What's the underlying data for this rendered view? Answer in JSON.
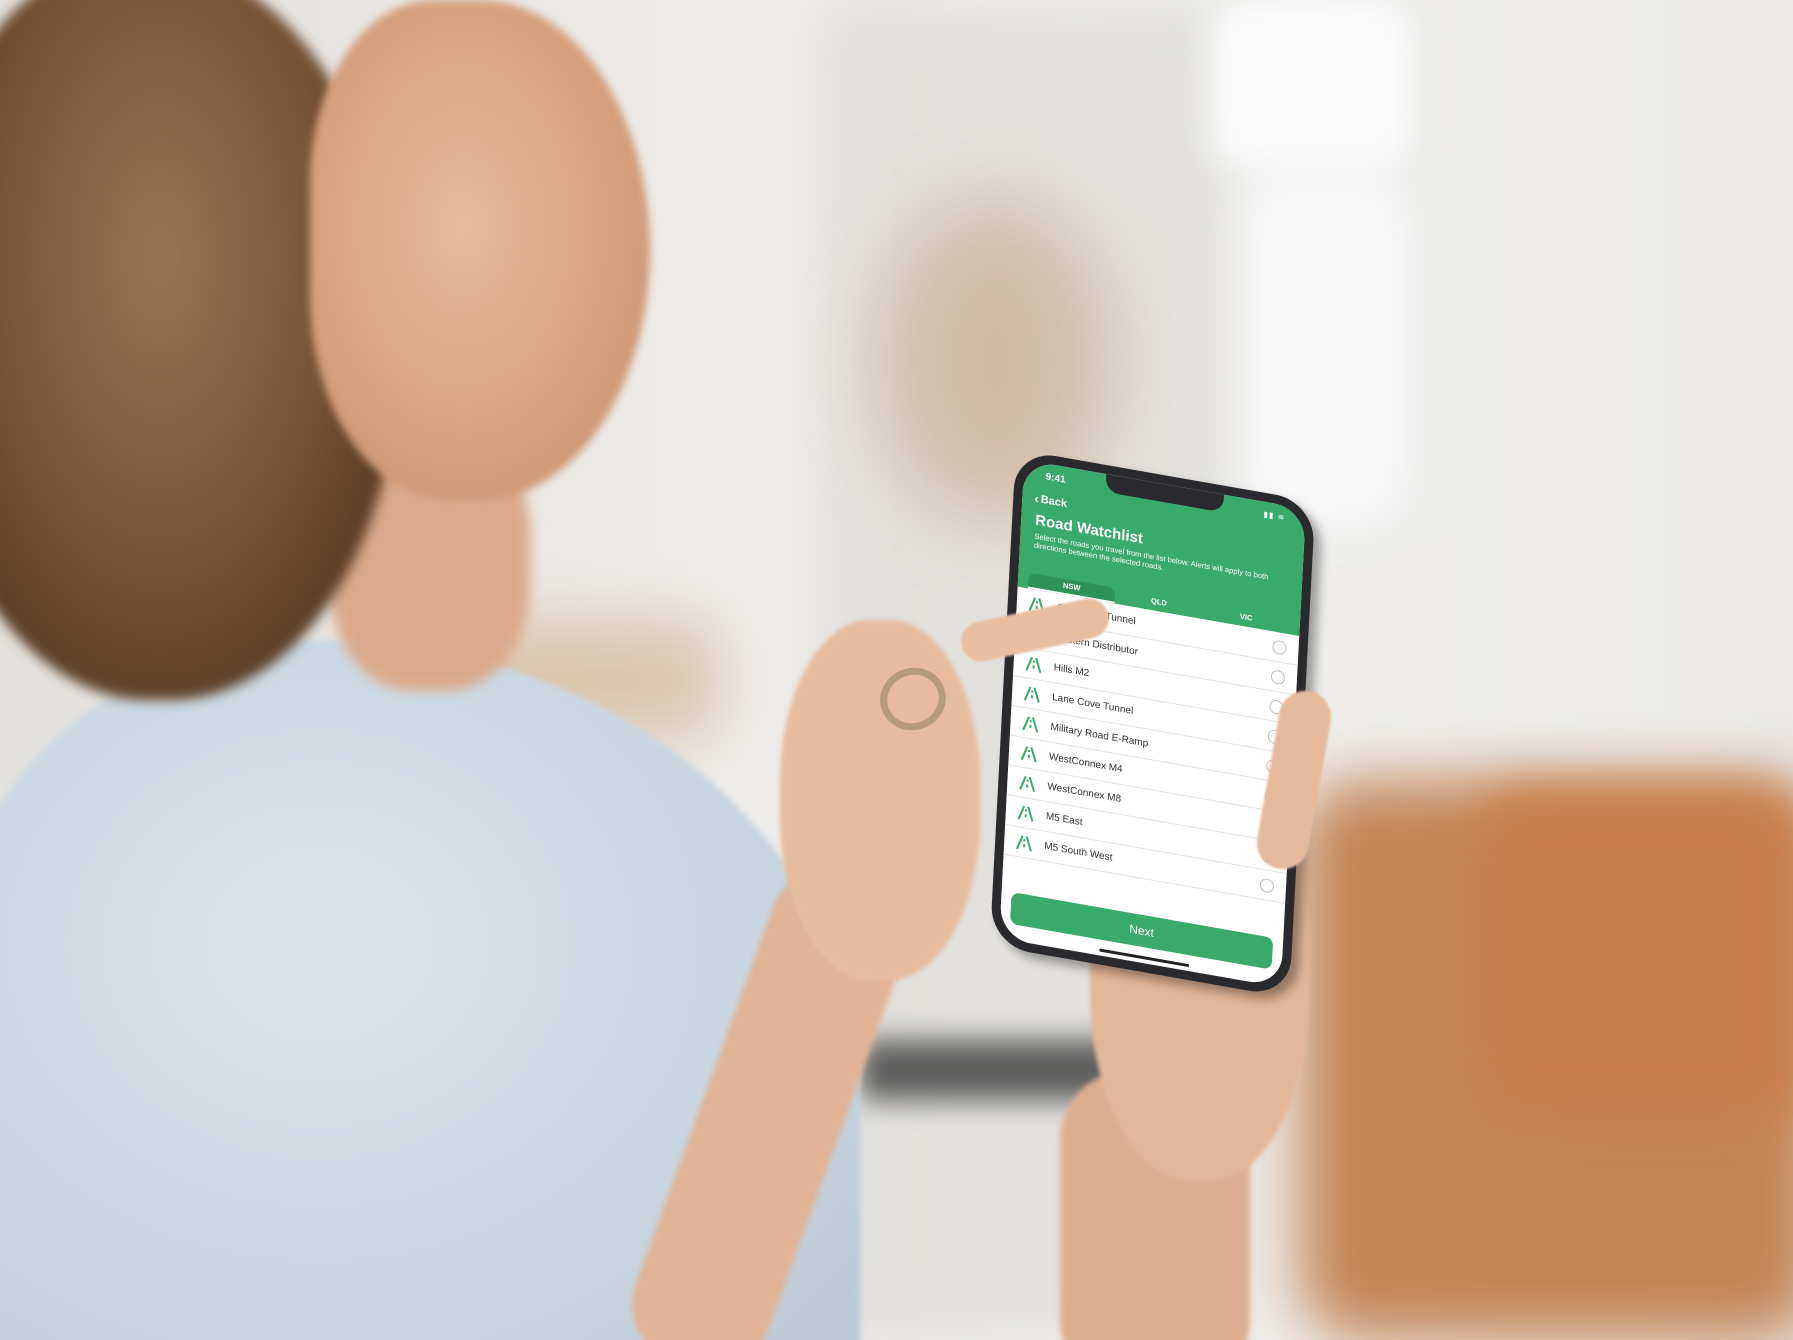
{
  "app": {
    "status_time": "9:41",
    "status_icons": "▮▮ ≋",
    "back_label": "Back",
    "title": "Road Watchlist",
    "subtitle": "Select the roads you travel from the list below. Alerts will apply to both directions between the selected roads.",
    "tabs": [
      {
        "label": "NSW",
        "active": true
      },
      {
        "label": "QLD",
        "active": false
      },
      {
        "label": "VIC",
        "active": false
      }
    ],
    "roads": [
      {
        "name": "Cross City Tunnel",
        "selected": false
      },
      {
        "name": "Eastern Distributor",
        "selected": false
      },
      {
        "name": "Hills M2",
        "selected": false
      },
      {
        "name": "Lane Cove Tunnel",
        "selected": false
      },
      {
        "name": "Military Road E-Ramp",
        "selected": false
      },
      {
        "name": "WestConnex M4",
        "selected": false
      },
      {
        "name": "WestConnex M8",
        "selected": false
      },
      {
        "name": "M5 East",
        "selected": false
      },
      {
        "name": "M5 South West",
        "selected": false
      }
    ],
    "next_label": "Next",
    "icons": {
      "road": "road-icon",
      "back": "chevron-left-icon",
      "radio": "radio-unchecked-icon"
    },
    "colors": {
      "accent": "#3aaa6a",
      "accent_dark": "#2f9358"
    }
  }
}
